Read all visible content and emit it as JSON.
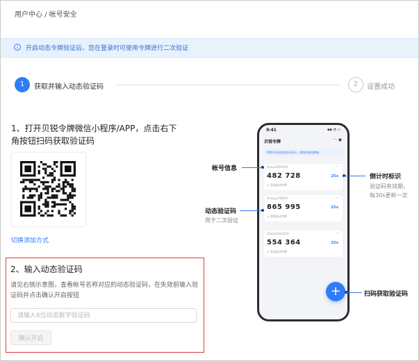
{
  "breadcrumb": "用户中心 / 帐号安全",
  "banner": {
    "icon": "info-icon",
    "text": "开启动态令牌验证后，您在登录时可使用令牌进行二次验证"
  },
  "steps": [
    {
      "number": "1",
      "label": "获取并输入动态验证码",
      "state": "active"
    },
    {
      "number": "2",
      "label": "设置成功",
      "state": "inactive"
    }
  ],
  "section1": {
    "title": "1、打开贝锐令牌微信小程序/APP，点击右下角按钮扫码获取验证码",
    "switch_link": "切换添加方式"
  },
  "section2": {
    "title": "2、输入动态验证码",
    "description": "请见右侧示意图，查看帐号名称对应的动态验证码，在失效前输入验证码并点击确认开启按钮",
    "input_placeholder": "请输入6位动态数字验证码",
    "input_value": "",
    "confirm_button": "确认开启"
  },
  "phone": {
    "time": "9:41",
    "status": "▪▪ ◔ ▭",
    "app_title": "贝锐令牌",
    "title_icons": "··· ◉",
    "tip": "令牌不在动态验证码显示，使用时请勿刷新…",
    "cards": [
      {
        "account": "Oray2356567",
        "code": "482 728",
        "seconds": "25s",
        "action": "◎ 添加自动令牌"
      },
      {
        "account": "Orayyy78642",
        "code": "865 995",
        "seconds": "25s",
        "action": "◎ 添加自动令牌"
      },
      {
        "account": "Orayzcbm243",
        "code": "554 364",
        "seconds": "25s",
        "action": "◎ 添加自动令牌"
      }
    ],
    "fab": "+"
  },
  "annotations": {
    "account_info": "帐号信息",
    "dynamic_code": "动态验证码",
    "dynamic_code_sub": "用于二次验证",
    "countdown": "倒计时标识",
    "countdown_sub1": "验证码有效期，",
    "countdown_sub2": "每30s更新一次",
    "scan": "扫码获取验证码"
  },
  "colors": {
    "accent": "#2f7cf6",
    "highlight_border": "#e0373f",
    "banner_bg": "#e8f2fd"
  }
}
